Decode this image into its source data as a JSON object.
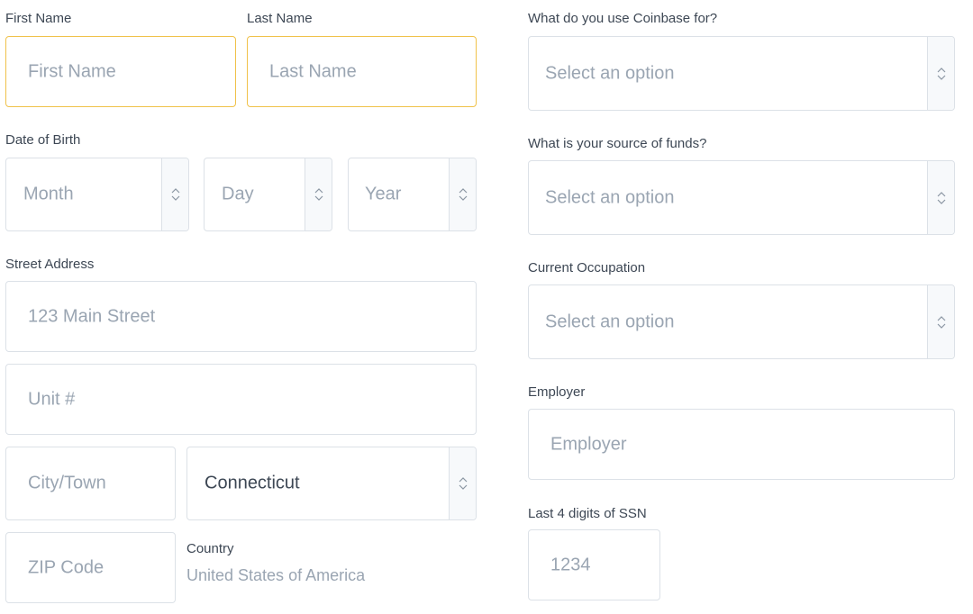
{
  "left": {
    "first_name": {
      "label": "First Name",
      "placeholder": "First Name"
    },
    "last_name": {
      "label": "Last Name",
      "placeholder": "Last Name"
    },
    "dob": {
      "label": "Date of Birth",
      "month": "Month",
      "day": "Day",
      "year": "Year"
    },
    "street": {
      "label": "Street Address",
      "placeholder": "123 Main Street"
    },
    "unit": {
      "placeholder": "Unit #"
    },
    "city": {
      "placeholder": "City/Town"
    },
    "state": {
      "value": "Connecticut"
    },
    "zip": {
      "placeholder": "ZIP Code"
    },
    "country": {
      "label": "Country",
      "value": "United States of America"
    }
  },
  "right": {
    "use": {
      "label": "What do you use Coinbase for?",
      "placeholder": "Select an option"
    },
    "funds": {
      "label": "What is your source of funds?",
      "placeholder": "Select an option"
    },
    "occupation": {
      "label": "Current Occupation",
      "placeholder": "Select an option"
    },
    "employer": {
      "label": "Employer",
      "placeholder": "Employer"
    },
    "ssn": {
      "label": "Last 4 digits of SSN",
      "placeholder": "1234"
    }
  },
  "colors": {
    "focus_border": "#f0c24a",
    "border": "#dce1e7",
    "placeholder": "#9aa5b2",
    "label": "#3d4754"
  },
  "icons": {
    "select_arrow": "chevron-up-down-icon"
  }
}
